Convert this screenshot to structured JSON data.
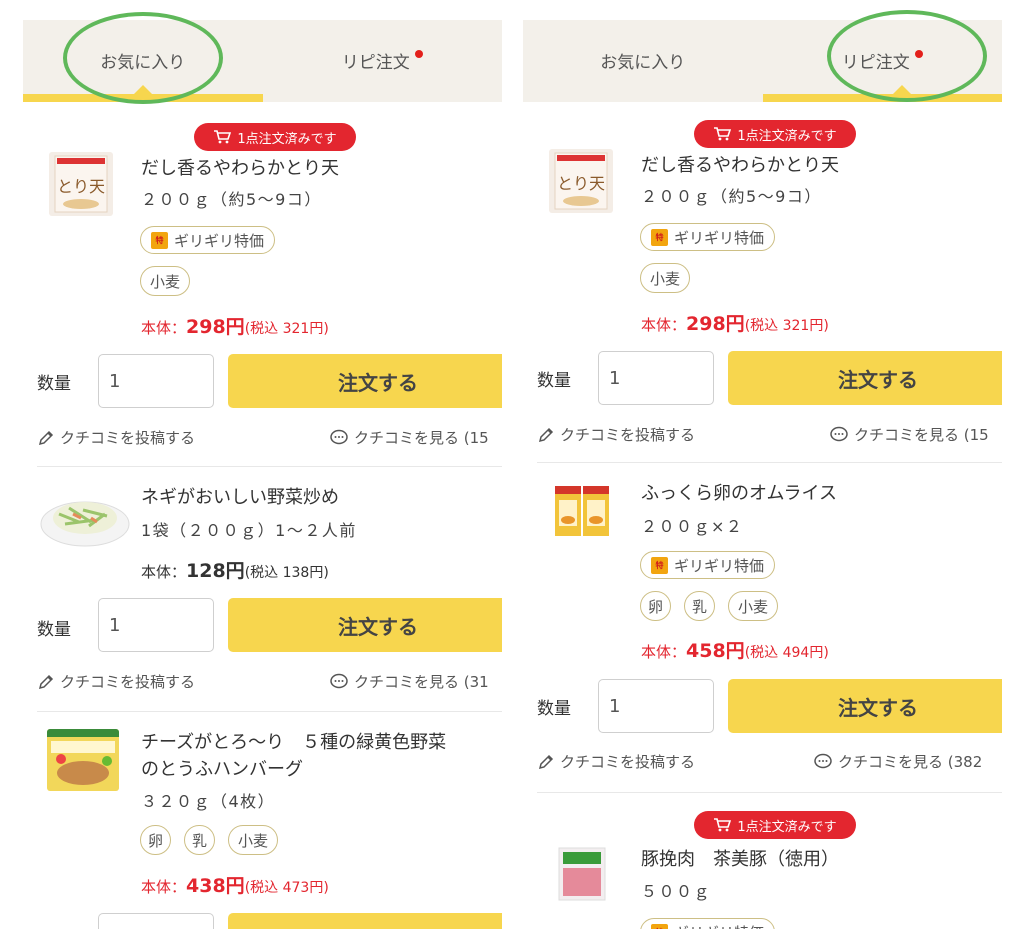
{
  "tabs": {
    "favorites": "お気に入り",
    "repeat": "リピ注文"
  },
  "common": {
    "qty_label": "数量",
    "qty_value": "1",
    "order_button": "注文する",
    "post_review": "クチコミを投稿する",
    "price_prefix": "本体：",
    "ordered_badge": "1点注文済みです",
    "special_tag": "ギリギリ特価",
    "special_icon_text": "ギリギリ特価"
  },
  "left": {
    "item1": {
      "name": "だし香るやわらかとり天",
      "spec": "２００ｇ（約5〜9コ）",
      "allergen": "小麦",
      "price": "298円",
      "tax": "(税込 321円)",
      "view": "クチコミを見る (15"
    },
    "item2": {
      "name": "ネギがおいしい野菜炒め",
      "spec": "1袋（２００ｇ）1〜２人前",
      "price": "128円",
      "tax": "(税込 138円)",
      "view": "クチコミを見る (31"
    },
    "item3": {
      "name_line1": "チーズがとろ〜り　５種の緑黄色野菜",
      "name_line2": "のとうふハンバーグ",
      "spec": "３２０ｇ（4枚）",
      "allergens": [
        "卵",
        "乳",
        "小麦"
      ],
      "price": "438円",
      "tax": "(税込 473円)"
    }
  },
  "right": {
    "item1": {
      "name": "だし香るやわらかとり天",
      "spec": "２００ｇ（約5〜9コ）",
      "allergen": "小麦",
      "price": "298円",
      "tax": "(税込 321円)",
      "view": "クチコミを見る (15"
    },
    "item2": {
      "name": "ふっくら卵のオムライス",
      "spec": "２００ｇ×２",
      "allergens": [
        "卵",
        "乳",
        "小麦"
      ],
      "price": "458円",
      "tax": "(税込 494円)",
      "view": "クチコミを見る (382"
    },
    "item3": {
      "name": "豚挽肉　茶美豚（徳用）",
      "spec": "５００ｇ"
    }
  },
  "colors": {
    "accent_yellow": "#f7d64e",
    "price_red": "#e3262f",
    "highlight_green": "#5fb85a"
  },
  "icons": [
    "cart-icon",
    "pencil-icon",
    "speech-bubble-icon",
    "notification-dot-icon"
  ]
}
